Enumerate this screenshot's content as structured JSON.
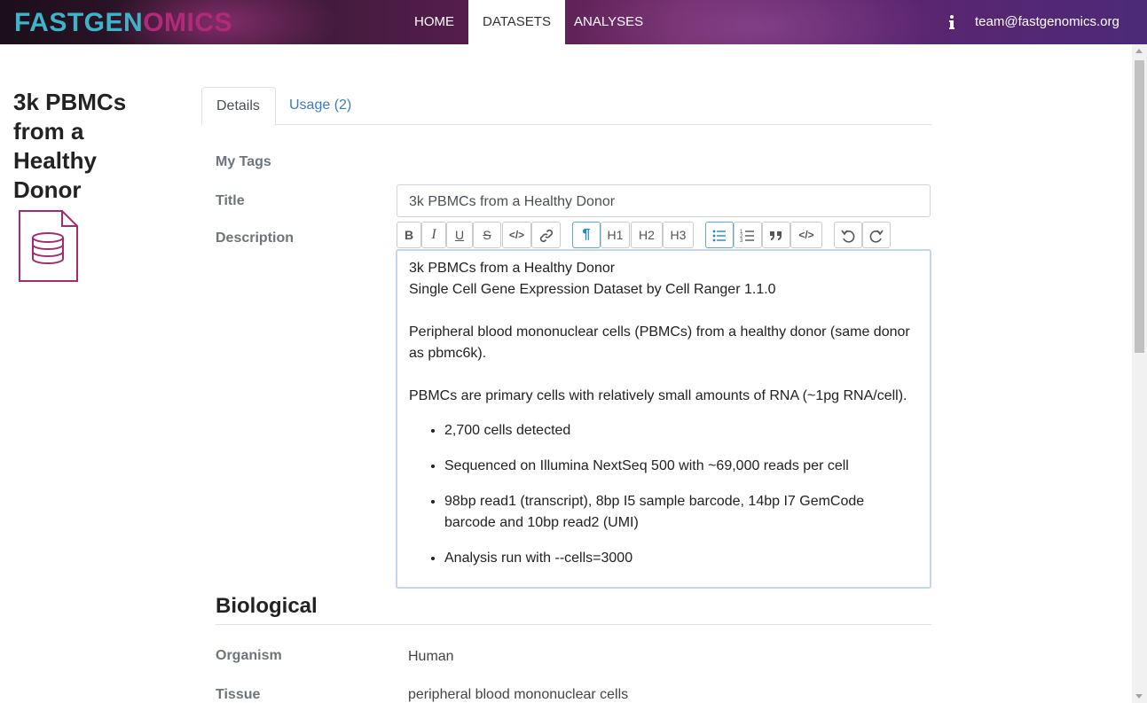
{
  "navbar": {
    "logo_part1": "FASTGEN",
    "logo_part2": "OMICS",
    "items": [
      {
        "label": "HOME"
      },
      {
        "label": "DATASETS"
      },
      {
        "label": "ANALYSES"
      }
    ],
    "active_item": "DATASETS",
    "info_icon": "info-icon",
    "user_email": "team@fastgenomics.org"
  },
  "page": {
    "title": "3k PBMCs from a Healthy Donor",
    "dataset_icon": "database-file-icon",
    "accent_color": "#a52a6e"
  },
  "tabs": [
    {
      "label": "Details",
      "active": true
    },
    {
      "label": "Usage (2)",
      "active": false
    }
  ],
  "details": {
    "tags_label": "My Tags",
    "title_label": "Title",
    "title_value": "3k PBMCs from a Healthy Donor",
    "description_label": "Description"
  },
  "toolbar": {
    "buttons": [
      {
        "name": "bold",
        "label": "B"
      },
      {
        "name": "italic",
        "label": "I"
      },
      {
        "name": "underline",
        "label": "U"
      },
      {
        "name": "strike",
        "label": "S"
      },
      {
        "name": "code",
        "label": "</>"
      },
      {
        "name": "link",
        "label": "link"
      },
      {
        "name": "paragraph",
        "label": "¶",
        "active": true
      },
      {
        "name": "h1",
        "label": "H1"
      },
      {
        "name": "h2",
        "label": "H2"
      },
      {
        "name": "h3",
        "label": "H3"
      },
      {
        "name": "bullet-list",
        "label": "bullets",
        "active": true
      },
      {
        "name": "ordered-list",
        "label": "numbers"
      },
      {
        "name": "quote",
        "label": "quote"
      },
      {
        "name": "code-block",
        "label": "</>"
      },
      {
        "name": "undo",
        "label": "undo"
      },
      {
        "name": "redo",
        "label": "redo"
      }
    ],
    "active_color": "#1a8ac6"
  },
  "description": {
    "line1": "3k PBMCs from a Healthy Donor",
    "line2": "Single Cell Gene Expression Dataset by Cell Ranger 1.1.0",
    "paragraph2": "Peripheral blood mononuclear cells (PBMCs) from a healthy donor (same donor as pbmc6k).",
    "paragraph3": "PBMCs are primary cells with relatively small amounts of RNA (~1pg RNA/cell).",
    "bullets": [
      "2,700 cells detected",
      "Sequenced on Illumina NextSeq 500 with ~69,000 reads per cell",
      "98bp read1 (transcript), 8bp I5 sample barcode, 14bp I7 GemCode barcode and 10bp read2 (UMI)",
      "Analysis run with --cells=3000"
    ]
  },
  "biological": {
    "heading": "Biological",
    "organism_label": "Organism",
    "organism_value": "Human",
    "tissue_label": "Tissue",
    "tissue_value": "peripheral blood mononuclear cells"
  }
}
